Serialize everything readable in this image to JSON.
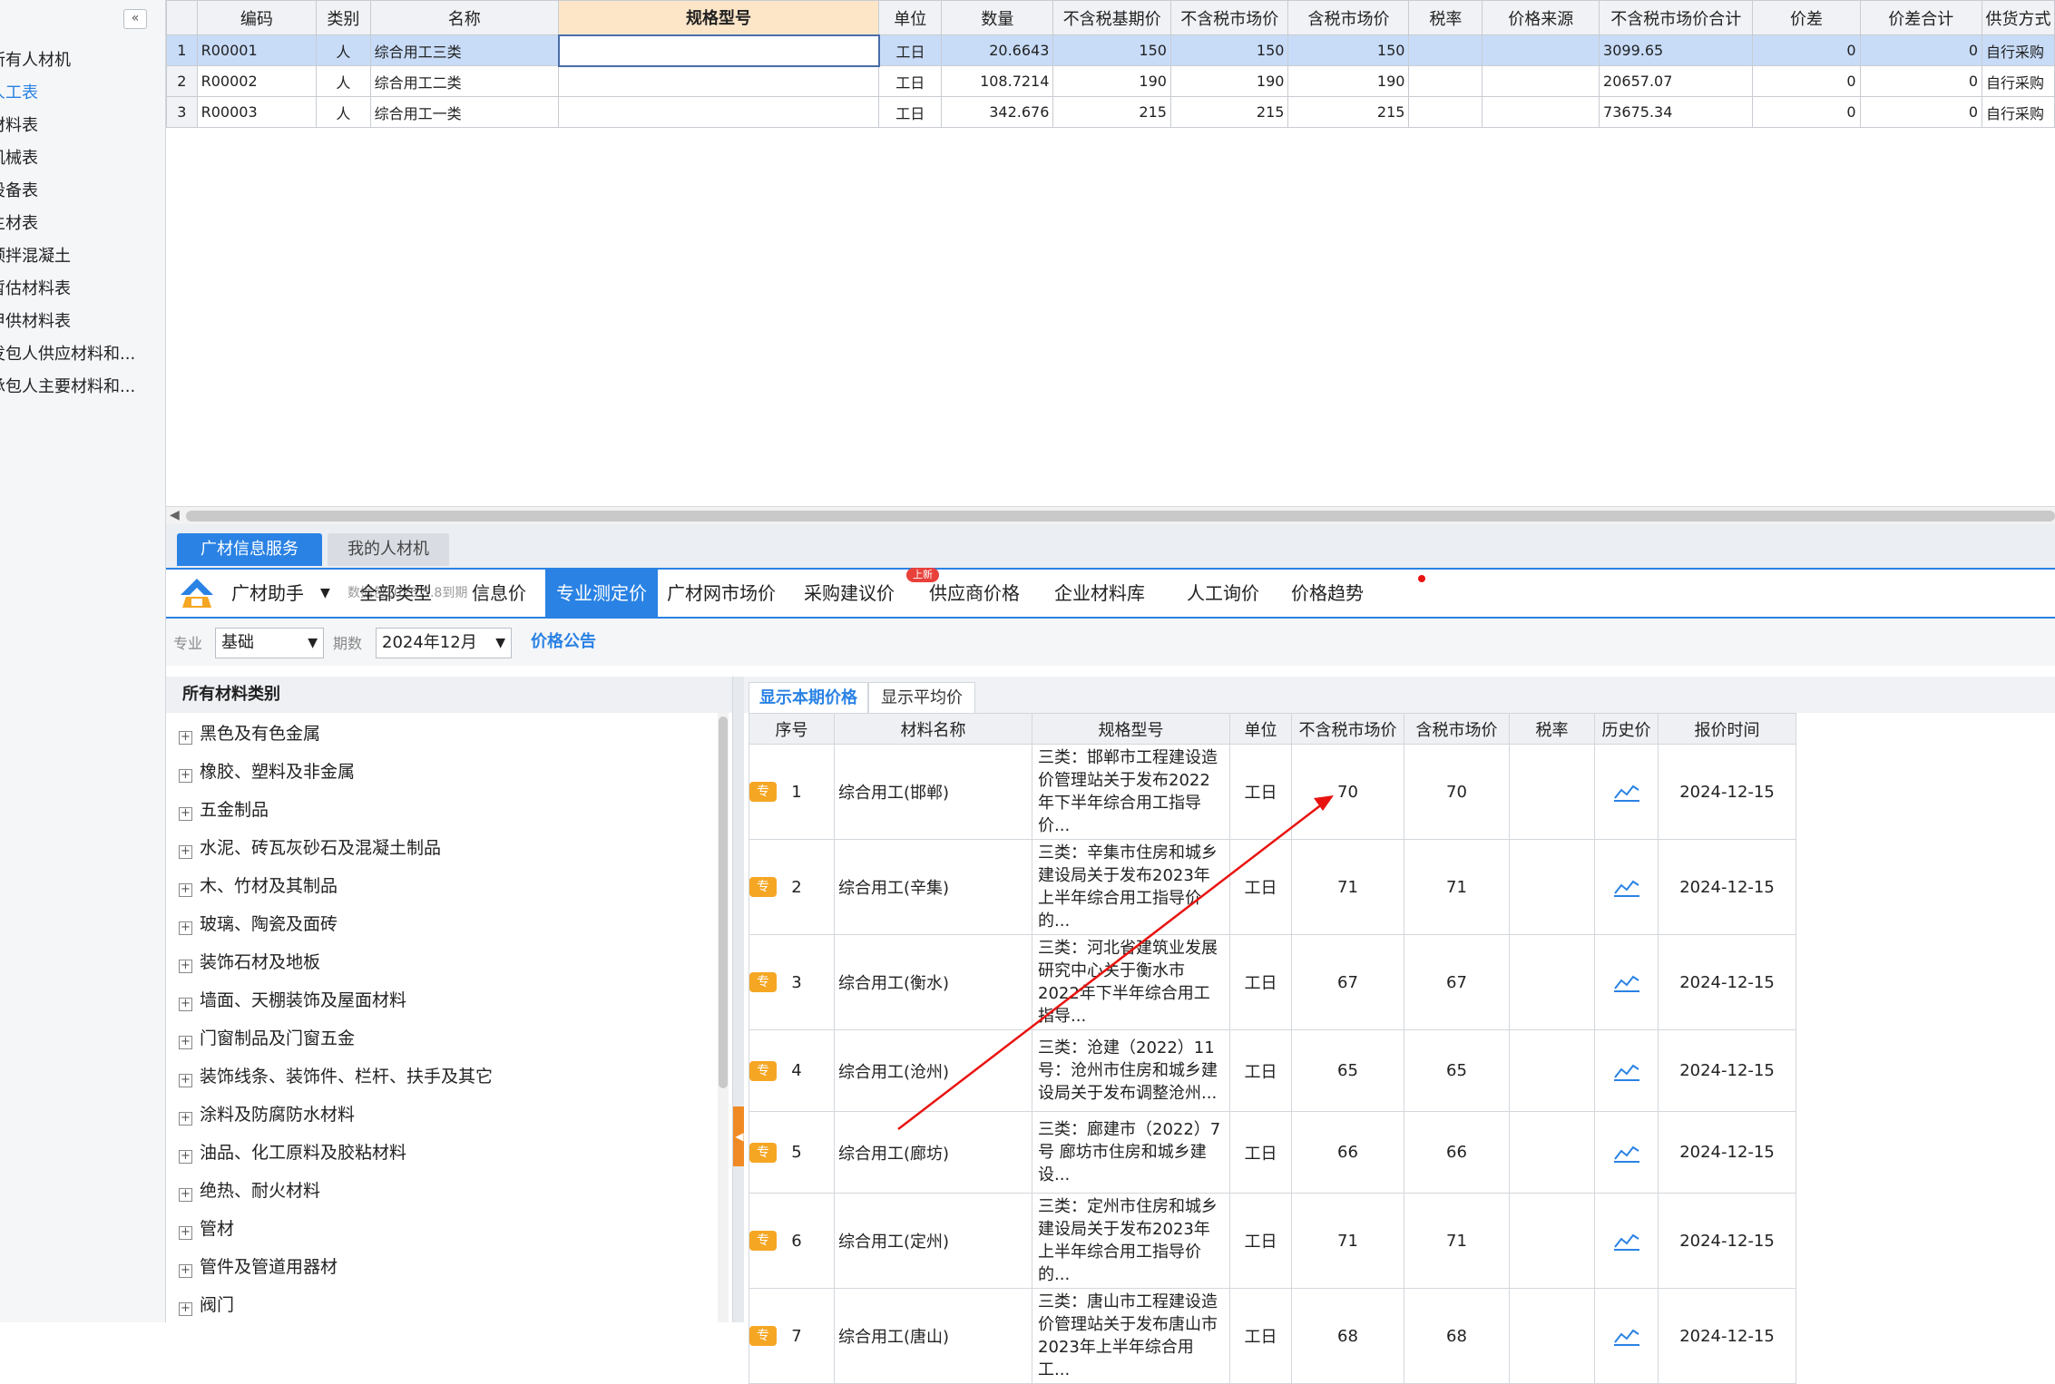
{
  "sidebar": {
    "collapse_label": "«",
    "items": [
      {
        "label": "所有人材机",
        "active": false
      },
      {
        "label": "人工表",
        "active": true
      },
      {
        "label": "材料表",
        "active": false
      },
      {
        "label": "机械表",
        "active": false
      },
      {
        "label": "设备表",
        "active": false
      },
      {
        "label": "主材表",
        "active": false
      },
      {
        "label": "预拌混凝土",
        "active": false
      },
      {
        "label": "暂估材料表",
        "active": false
      },
      {
        "label": "甲供材料表",
        "active": false
      },
      {
        "label": "发包人供应材料和...",
        "active": false
      },
      {
        "label": "承包人主要材料和...",
        "active": false
      }
    ]
  },
  "grid": {
    "headers": [
      "",
      "编码",
      "类别",
      "名称",
      "规格型号",
      "单位",
      "数量",
      "不含税基期价",
      "不含税市场价",
      "含税市场价",
      "税率",
      "价格来源",
      "不含税市场价合计",
      "价差",
      "价差合计",
      "供货方式"
    ],
    "rows": [
      {
        "rownum": "1",
        "code": "R00001",
        "type": "人",
        "name": "综合用工三类",
        "spec": "",
        "unit": "工日",
        "qty": "20.6643",
        "base_price": "150",
        "market_price": "150",
        "tax_price": "150",
        "tax_rate": "",
        "source": "",
        "total": "3099.65",
        "diff": "0",
        "diff_total": "0",
        "supply": "自行采购"
      },
      {
        "rownum": "2",
        "code": "R00002",
        "type": "人",
        "name": "综合用工二类",
        "spec": "",
        "unit": "工日",
        "qty": "108.7214",
        "base_price": "190",
        "market_price": "190",
        "tax_price": "190",
        "tax_rate": "",
        "source": "",
        "total": "20657.07",
        "diff": "0",
        "diff_total": "0",
        "supply": "自行采购"
      },
      {
        "rownum": "3",
        "code": "R00003",
        "type": "人",
        "name": "综合用工一类",
        "spec": "",
        "unit": "工日",
        "qty": "342.676",
        "base_price": "215",
        "market_price": "215",
        "tax_price": "215",
        "tax_rate": "",
        "source": "",
        "total": "73675.34",
        "diff": "0",
        "diff_total": "0",
        "supply": "自行采购"
      }
    ]
  },
  "panel_tabs": [
    "广材信息服务",
    "我的人材机"
  ],
  "toolbar": {
    "assistant_label": "广材助手",
    "data_package": "数据包2026.5.8到期",
    "nav": [
      "全部类型",
      "信息价",
      "专业测定价",
      "广材网市场价",
      "采购建议价",
      "供应商价格",
      "企业材料库",
      "人工询价",
      "价格趋势"
    ],
    "active_nav": "专业测定价",
    "new_badge": "上新"
  },
  "filters": {
    "major_label": "专业",
    "major_value": "基础",
    "period_label": "期数",
    "period_value": "2024年12月",
    "notice_link": "价格公告"
  },
  "categories": {
    "header": "所有材料类别",
    "items": [
      "黑色及有色金属",
      "橡胶、塑料及非金属",
      "五金制品",
      "水泥、砖瓦灰砂石及混凝土制品",
      "木、竹材及其制品",
      "玻璃、陶瓷及面砖",
      "装饰石材及地板",
      "墙面、天棚装饰及屋面材料",
      "门窗制品及门窗五金",
      "装饰线条、装饰件、栏杆、扶手及其它",
      "涂料及防腐防水材料",
      "油品、化工原料及胶粘材料",
      "绝热、耐火材料",
      "管材",
      "管件及管道用器材",
      "阀门"
    ]
  },
  "price_panel": {
    "subtabs": [
      "显示本期价格",
      "显示平均价"
    ],
    "headers": [
      "序号",
      "材料名称",
      "规格型号",
      "单位",
      "不含税市场价",
      "含税市场价",
      "税率",
      "历史价",
      "报价时间"
    ],
    "badge": "专",
    "rows": [
      {
        "seq": "1",
        "name": "综合用工(邯郸)",
        "spec": "三类：邯郸市工程建设造价管理站关于发布2022年下半年综合用工指导价...",
        "unit": "工日",
        "price_ex": "70",
        "price_in": "70",
        "tax": "",
        "date": "2024-12-15"
      },
      {
        "seq": "2",
        "name": "综合用工(辛集)",
        "spec": "三类：辛集市住房和城乡建设局关于发布2023年上半年综合用工指导价的...",
        "unit": "工日",
        "price_ex": "71",
        "price_in": "71",
        "tax": "",
        "date": "2024-12-15"
      },
      {
        "seq": "3",
        "name": "综合用工(衡水)",
        "spec": "三类：河北省建筑业发展研究中心关于衡水市2022年下半年综合用工指导...",
        "unit": "工日",
        "price_ex": "67",
        "price_in": "67",
        "tax": "",
        "date": "2024-12-15"
      },
      {
        "seq": "4",
        "name": "综合用工(沧州)",
        "spec": "三类：沧建（2022）11号：沧州市住房和城乡建设局关于发布调整沧州...",
        "unit": "工日",
        "price_ex": "65",
        "price_in": "65",
        "tax": "",
        "date": "2024-12-15"
      },
      {
        "seq": "5",
        "name": "综合用工(廊坊)",
        "spec": "三类：廊建市（2022）7号 廊坊市住房和城乡建设...",
        "unit": "工日",
        "price_ex": "66",
        "price_in": "66",
        "tax": "",
        "date": "2024-12-15"
      },
      {
        "seq": "6",
        "name": "综合用工(定州)",
        "spec": "三类：定州市住房和城乡建设局关于发布2023年上半年综合用工指导价的...",
        "unit": "工日",
        "price_ex": "71",
        "price_in": "71",
        "tax": "",
        "date": "2024-12-15"
      },
      {
        "seq": "7",
        "name": "综合用工(唐山)",
        "spec": "三类：唐山市工程建设造价管理站关于发布唐山市2023年上半年综合用工...",
        "unit": "工日",
        "price_ex": "68",
        "price_in": "68",
        "tax": "",
        "date": "2024-12-15"
      }
    ]
  },
  "colors": {
    "accent": "#2a82e4",
    "badge": "#f5a623",
    "arrow": "#e8130f",
    "selected_row": "#c8dcf8"
  }
}
